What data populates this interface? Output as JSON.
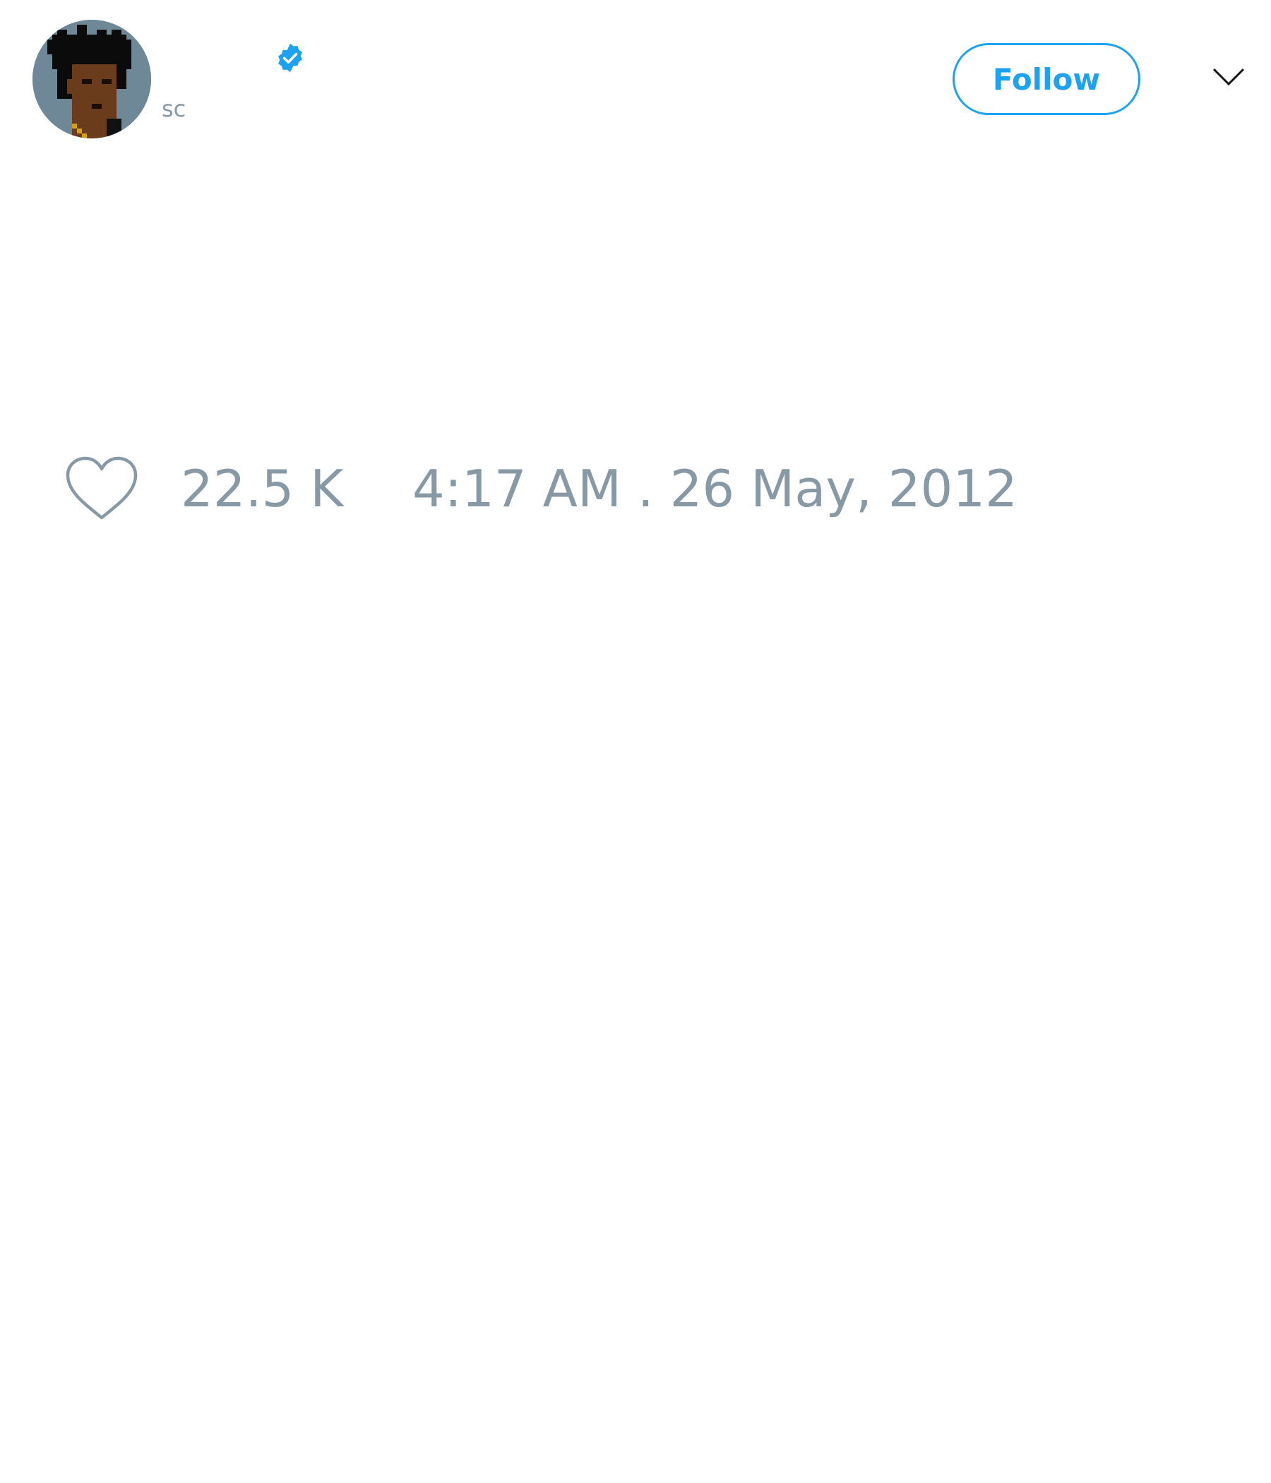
{
  "tweet": {
    "author": {
      "handle": "sc",
      "verified": true
    },
    "follow_label": "Follow",
    "likes": "22.5 K",
    "timestamp": "4:17 AM . 26 May, 2012"
  },
  "icons": {
    "verified": "verified-badge-icon",
    "more": "chevron-down-icon",
    "like": "heart-outline-icon"
  },
  "colors": {
    "accent": "#1da1f2",
    "muted_text": "#8899a6",
    "background": "#ffffff"
  }
}
